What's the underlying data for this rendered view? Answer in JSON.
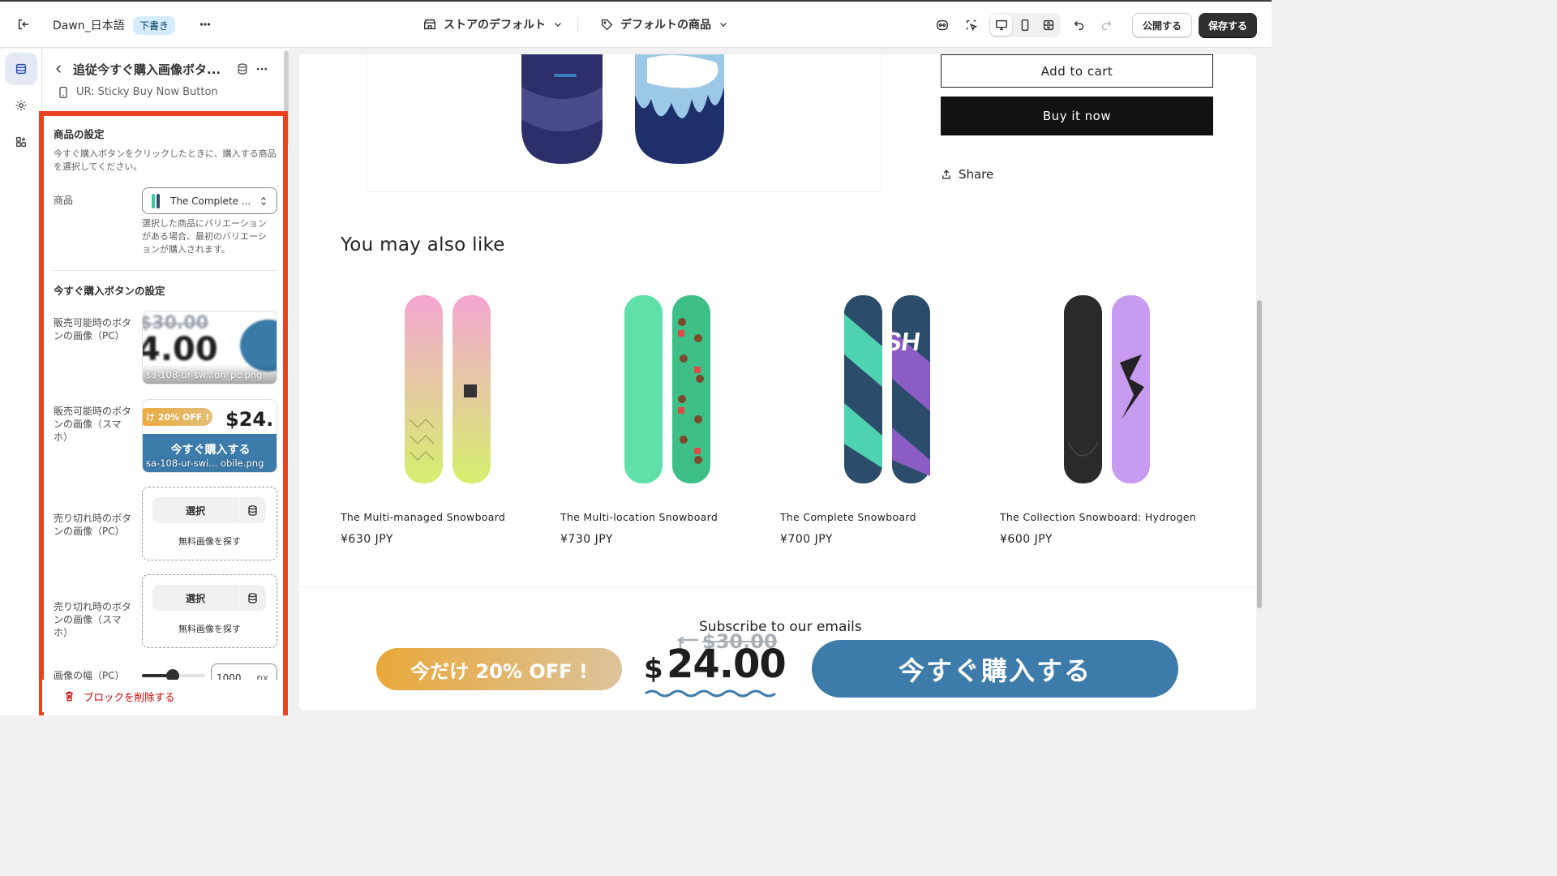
{
  "topbar": {
    "store_name": "Dawn_日本語",
    "status_badge": "下書き",
    "template_selector": "ストアのデフォルト",
    "product_selector": "デフォルトの商品",
    "publish_label": "公開する",
    "save_label": "保存する"
  },
  "panel": {
    "title": "追従今すぐ購入画像ボタ...",
    "subtitle": "UR: Sticky Buy Now Button",
    "product_section": {
      "heading": "商品の設定",
      "help": "今すぐ購入ボタンをクリックしたときに、購入する商品を選択してください。",
      "product_label": "商品",
      "product_value": "The Complete ...",
      "product_help": "選択した商品にバリエーションがある場合、最初のバリエーションが購入されます。"
    },
    "button_section": {
      "heading": "今すぐ購入ボタンの設定",
      "available_pc_label": "販売可能時のボタンの画像（PC）",
      "available_pc_file": "sa-108-ur-sw...on_pc.png",
      "available_pc_thumb": {
        "old_price": "$30.00",
        "price": "4.00"
      },
      "available_sp_label": "販売可能時のボタンの画像（スマホ）",
      "available_sp_file": "sa-108-ur-swi... obile.png",
      "available_sp_thumb": {
        "promo": "け 20% OFF !",
        "price": "$24.",
        "cta": "今すぐ購入する"
      },
      "soldout_pc_label": "売り切れ時のボタンの画像（PC）",
      "soldout_sp_label": "売り切れ時のボタンの画像（スマホ）",
      "select_label": "選択",
      "free_image_link": "無料画像を探す",
      "width_pc_label": "画像の幅（PC）",
      "width_pc_value": "1000",
      "width_unit": "px"
    },
    "delete_label": "ブロックを削除する"
  },
  "preview": {
    "add_to_cart": "Add to cart",
    "buy_now": "Buy it now",
    "share": "Share",
    "section_heading": "You may also like",
    "products": [
      {
        "title": "The Multi-managed Snowboard",
        "price": "¥630 JPY"
      },
      {
        "title": "The Multi-location Snowboard",
        "price": "¥730 JPY"
      },
      {
        "title": "The Complete Snowboard",
        "price": "¥700 JPY"
      },
      {
        "title": "The Collection Snowboard: Hydrogen",
        "price": "¥600 JPY"
      }
    ],
    "subscribe_heading": "Subscribe to our emails",
    "sticky_banner": {
      "promo": "今だけ 20% OFF !",
      "old_price": "$30.00",
      "currency": "$",
      "price": "24.00",
      "cta": "今すぐ購入する"
    }
  },
  "colors": {
    "highlight": "#e8431c",
    "banner_blue": "#3d7bab",
    "banner_gold": "#e9a73a",
    "primary_button": "#303030"
  }
}
